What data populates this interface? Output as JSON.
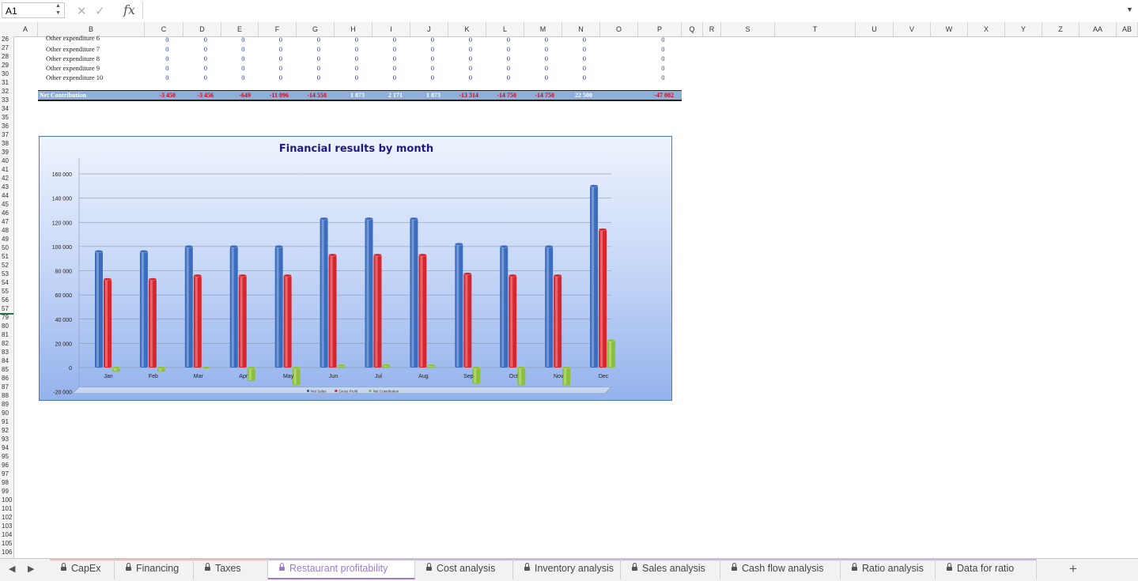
{
  "formula_bar": {
    "name_box": "A1",
    "cancel_icon": "✕",
    "accept_icon": "✓",
    "fx_label": "fx",
    "formula": ""
  },
  "columns": [
    "A",
    "B",
    "C",
    "D",
    "E",
    "F",
    "G",
    "H",
    "I",
    "J",
    "K",
    "L",
    "M",
    "N",
    "O",
    "P",
    "Q",
    "R",
    "S",
    "T",
    "U",
    "V",
    "W",
    "X",
    "Y",
    "Z",
    "AA",
    "AB"
  ],
  "row_numbers": [
    "26",
    "27",
    "28",
    "29",
    "30",
    "31",
    "32",
    "33",
    "34",
    "35",
    "36",
    "37",
    "38",
    "39",
    "40",
    "41",
    "42",
    "43",
    "44",
    "45",
    "46",
    "47",
    "48",
    "49",
    "50",
    "51",
    "52",
    "53",
    "54",
    "55",
    "56",
    "57",
    "79",
    "80",
    "81",
    "82",
    "83",
    "84",
    "85",
    "86",
    "87",
    "88",
    "89",
    "90",
    "91",
    "92",
    "93",
    "94",
    "95",
    "96",
    "97",
    "98",
    "99",
    "100",
    "101",
    "102",
    "103",
    "104",
    "105",
    "106"
  ],
  "rows": [
    {
      "label": "Other expenditure 6",
      "values": [
        "0",
        "0",
        "0",
        "0",
        "0",
        "0",
        "0",
        "0",
        "0",
        "0",
        "0",
        "0",
        "0"
      ]
    },
    {
      "label": "Other expenditure 7",
      "values": [
        "0",
        "0",
        "0",
        "0",
        "0",
        "0",
        "0",
        "0",
        "0",
        "0",
        "0",
        "0",
        "0"
      ]
    },
    {
      "label": "Other expenditure 8",
      "values": [
        "0",
        "0",
        "0",
        "0",
        "0",
        "0",
        "0",
        "0",
        "0",
        "0",
        "0",
        "0",
        "0"
      ]
    },
    {
      "label": "Other expenditure 9",
      "values": [
        "0",
        "0",
        "0",
        "0",
        "0",
        "0",
        "0",
        "0",
        "0",
        "0",
        "0",
        "0",
        "0"
      ]
    },
    {
      "label": "Other expenditure 10",
      "values": [
        "0",
        "0",
        "0",
        "0",
        "0",
        "0",
        "0",
        "0",
        "0",
        "0",
        "0",
        "0",
        "0"
      ]
    }
  ],
  "net_contribution": {
    "label": "Net Contribution",
    "values": [
      "-3 450",
      "-3 456",
      "-649",
      "-11 096",
      "-14 558",
      "1 873",
      "2 171",
      "1 873",
      "-13 314",
      "-14 750",
      "-14 750",
      "22 500",
      "-47 082"
    ],
    "negative_color": "#e0001b",
    "positive_color": "#ffffff"
  },
  "chart_data": {
    "type": "bar",
    "title": "Financial results by month",
    "categories": [
      "Jan",
      "Feb",
      "Mar",
      "Apr",
      "May",
      "Jun",
      "Jul",
      "Aug",
      "Sep",
      "Oct",
      "Nov",
      "Dec"
    ],
    "series": [
      {
        "name": "Net Sales",
        "color": "#3a6cc0",
        "values": [
          96000,
          96000,
          100000,
          100000,
          100000,
          123000,
          123000,
          123000,
          102000,
          100000,
          100000,
          150000
        ]
      },
      {
        "name": "Gross Profit",
        "color": "#d8262e",
        "values": [
          73000,
          73000,
          76000,
          76000,
          76000,
          93000,
          93000,
          93000,
          77500,
          76000,
          76000,
          114000
        ]
      },
      {
        "name": "Net Contribution",
        "color": "#8cbf3a",
        "values": [
          -3450,
          -3456,
          -649,
          -11096,
          -14558,
          1873,
          2171,
          1873,
          -13314,
          -14750,
          -14750,
          22500
        ]
      }
    ],
    "yticks": [
      "160 000",
      "140 000",
      "120 000",
      "100 000",
      "80 000",
      "60 000",
      "40 000",
      "20 000",
      "0",
      "-20 000"
    ],
    "ylim": [
      -20000,
      160000
    ],
    "grid": true,
    "legend": "bottom"
  },
  "tabs": [
    {
      "label": "CapEx",
      "stripe": "#f4b6b6"
    },
    {
      "label": "Financing",
      "stripe": "#f4b6b6"
    },
    {
      "label": "Taxes",
      "stripe": "#f4b6b6"
    },
    {
      "label": "Restaurant profitability",
      "stripe": "#c9b6e6",
      "active": true
    },
    {
      "label": "Cost analysis",
      "stripe": "#c9b6e6"
    },
    {
      "label": "Inventory analysis",
      "stripe": "#c9b6e6"
    },
    {
      "label": "Sales analysis",
      "stripe": "#c9b6e6"
    },
    {
      "label": "Cash flow analysis",
      "stripe": "#c9b6e6"
    },
    {
      "label": "Ratio analysis",
      "stripe": "#c9b6e6"
    },
    {
      "label": "Data for ratio",
      "stripe": "#c9b6e6"
    }
  ],
  "add_sheet_label": "+",
  "nav_prev": "◀",
  "nav_next": "▶"
}
